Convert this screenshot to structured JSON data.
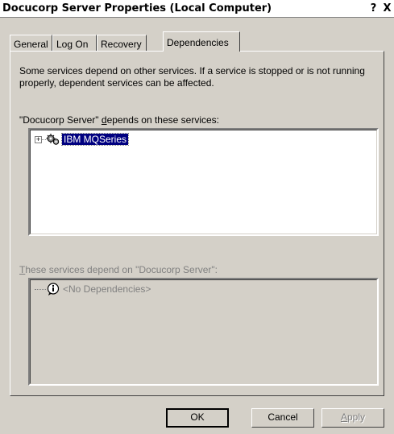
{
  "window": {
    "title": "Docucorp Server Properties (Local Computer)",
    "help_button": "?",
    "close_button": "X"
  },
  "tabs": [
    {
      "label": "General"
    },
    {
      "label": "Log On"
    },
    {
      "label": "Recovery"
    },
    {
      "label": "Dependencies",
      "active": true
    }
  ],
  "dependencies": {
    "description": "Some services depend on other services. If a service is stopped or is not running properly, dependent services can be affected.",
    "depends_on_label_prefix": "\"Docucorp Server\" ",
    "depends_on_label_access": "d",
    "depends_on_label_suffix": "epends on these services:",
    "depends_on_items": [
      {
        "label": "IBM MQSeries",
        "icon": "service-gears-icon",
        "expander": "+",
        "selected": true
      }
    ],
    "dependents_label_access": "T",
    "dependents_label_suffix": "hese services depend on \"Docucorp Server\":",
    "dependents_items": [
      {
        "label": "<No Dependencies>",
        "icon": "info-icon"
      }
    ]
  },
  "buttons": {
    "ok": "OK",
    "cancel": "Cancel",
    "apply_access": "A",
    "apply_rest": "pply"
  }
}
